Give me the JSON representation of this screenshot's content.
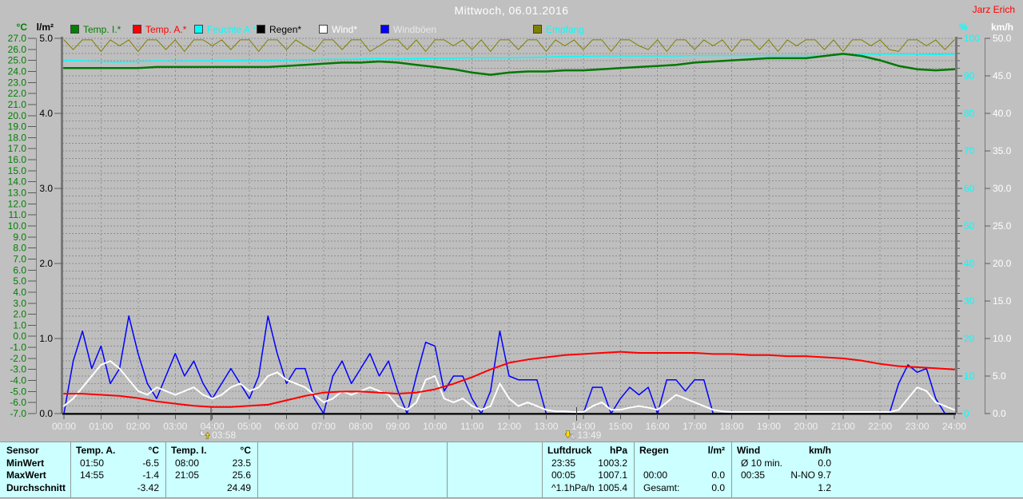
{
  "window": {
    "title": "Mittwoch, 06.01.2016",
    "watermark": "Jarz Erich"
  },
  "legend": {
    "items": [
      {
        "id": "temp-i",
        "label": "Temp. I.*",
        "swatch": "#008000",
        "text_color": "#008000"
      },
      {
        "id": "temp-a",
        "label": "Temp. A.*",
        "swatch": "#ff0000",
        "text_color": "#ff0000"
      },
      {
        "id": "feuchte-a",
        "label": "Feuchte A.*",
        "swatch": "#00ffff",
        "text_color": "#00ffff"
      },
      {
        "id": "regen",
        "label": "Regen*",
        "swatch": "#000000",
        "text_color": "#000000"
      },
      {
        "id": "wind",
        "label": "Wind*",
        "swatch": "#ffffff",
        "text_color": "#ffffff"
      },
      {
        "id": "windboeen",
        "label": "Windböen",
        "swatch": "#0000ff",
        "text_color": "#e8e8e8"
      },
      {
        "id": "empfang",
        "label": "Empfang",
        "swatch": "#808000",
        "text_color": "#00ffff"
      }
    ]
  },
  "colors": {
    "background": "#c0c0c0",
    "plot_bg": "#bebebe",
    "grid": "#8e8e8e",
    "axis_line": "#787878",
    "tick": "#5a5a5a",
    "x_label": "#f0f0f0",
    "baseline": "#000000",
    "table_bg": "#ccffff",
    "title": "#ffffff",
    "watermark": "#ff0000"
  },
  "chart_data": {
    "type": "line",
    "title": "Mittwoch, 06.01.2016",
    "x_axis": {
      "hours": 24,
      "labels": [
        "00:00",
        "01:00",
        "02:00",
        "03:00",
        "04:00",
        "05:00",
        "06:00",
        "07:00",
        "08:00",
        "09:00",
        "10:00",
        "11:00",
        "12:00",
        "13:00",
        "14:00",
        "15:00",
        "16:00",
        "17:00",
        "18:00",
        "19:00",
        "20:00",
        "21:00",
        "22:00",
        "23:00",
        "24:00"
      ]
    },
    "axes": {
      "temp_c": {
        "unit": "°C",
        "min": -7,
        "max": 27,
        "step": 1,
        "color": "#008000",
        "side": "left"
      },
      "rain_lm2": {
        "unit": "l/m²",
        "min": 0,
        "max": 5,
        "step": 1,
        "color": "#000000",
        "side": "left"
      },
      "humidity_pct": {
        "unit": "%",
        "min": 0,
        "max": 100,
        "step": 10,
        "minor_step": 2,
        "color": "#00ffff",
        "side": "right"
      },
      "wind_kmh": {
        "unit": "km/h",
        "min": 0,
        "max": 50,
        "step": 5,
        "color": "#ffffff",
        "side": "right"
      }
    },
    "markers": [
      {
        "time": "03:58",
        "hour": 3.967,
        "icon": "moonrise"
      },
      {
        "time": "13:49",
        "hour": 13.817,
        "icon": "moonset"
      }
    ],
    "series": [
      {
        "id": "empfang",
        "name": "Empfang",
        "axis": "humidity_pct",
        "color": "#808000",
        "width": 1,
        "interval_h": 0.25,
        "values": [
          99.6,
          97,
          99.6,
          99.6,
          96.5,
          99.6,
          98,
          99.6,
          96.5,
          99.6,
          99.6,
          97,
          99.6,
          96.5,
          99.6,
          99.6,
          98,
          99.6,
          97,
          99.6,
          99.6,
          96.5,
          99.6,
          99.6,
          97,
          99.6,
          98,
          96.5,
          99.6,
          99.6,
          97,
          99.6,
          99.6,
          96.5,
          98,
          99.6,
          99.6,
          97,
          99.6,
          96.5,
          99.6,
          99.6,
          98,
          99.6,
          97,
          99.6,
          96.5,
          99.6,
          99.6,
          97,
          99.6,
          99.6,
          96.5,
          99.6,
          98,
          99.6,
          97,
          99.6,
          99.6,
          96.5,
          99.6,
          99.6,
          98,
          97,
          99.6,
          96.5,
          99.6,
          99.6,
          97,
          99.6,
          98,
          99.6,
          96.5,
          99.6,
          99.6,
          97,
          99.6,
          96.5,
          99.6,
          98,
          99.6,
          99.6,
          97,
          99.6,
          96.5,
          99.6,
          99.6,
          98,
          99.6,
          97,
          96.5,
          99.6,
          99.6,
          98,
          99.6,
          97,
          99.6
        ]
      },
      {
        "id": "feuchte-a",
        "name": "Feuchte A.",
        "axis": "humidity_pct",
        "color": "#00ffff",
        "width": 1.5,
        "interval_h": 0.5,
        "values": [
          94.2,
          94.0,
          93.8,
          93.7,
          93.8,
          94.0,
          93.9,
          94.0,
          94.0,
          94.1,
          94.2,
          94.2,
          94.2,
          94.3,
          94.4,
          94.4,
          94.5,
          94.6,
          94.5,
          94.6,
          94.7,
          94.7,
          94.8,
          94.8,
          94.8,
          94.9,
          95.0,
          95.2,
          95.2,
          95.3,
          95.3,
          95.3,
          95.3,
          95.3,
          95.4,
          95.4,
          95.4,
          95.4,
          95.4,
          95.4,
          95.4,
          95.4,
          95.5,
          95.8,
          95.8,
          95.8,
          95.8,
          95.7,
          95.8
        ]
      },
      {
        "id": "temp-i",
        "name": "Temp. I.",
        "axis": "temp_c",
        "color": "#007800",
        "width": 2.5,
        "interval_h": 0.5,
        "values": [
          24.3,
          24.3,
          24.3,
          24.3,
          24.3,
          24.4,
          24.4,
          24.4,
          24.4,
          24.4,
          24.4,
          24.4,
          24.5,
          24.6,
          24.7,
          24.8,
          24.8,
          24.9,
          24.8,
          24.6,
          24.4,
          24.2,
          23.9,
          23.7,
          23.9,
          24.0,
          24.0,
          24.1,
          24.1,
          24.2,
          24.3,
          24.4,
          24.5,
          24.6,
          24.8,
          24.9,
          25.0,
          25.1,
          25.2,
          25.2,
          25.2,
          25.4,
          25.6,
          25.4,
          25.0,
          24.5,
          24.2,
          24.1,
          24.2
        ]
      },
      {
        "id": "windboeen",
        "name": "Windböen",
        "axis": "wind_kmh",
        "color": "#0000ff",
        "width": 1.5,
        "interval_h": 0.25,
        "values": [
          0,
          7,
          11,
          6,
          9,
          4,
          6,
          13,
          8,
          4,
          2,
          5,
          8,
          5,
          7,
          4,
          2,
          4,
          6,
          4,
          2,
          5,
          13,
          8,
          4,
          6,
          6,
          2,
          0,
          5,
          7,
          4,
          6,
          8,
          5,
          7,
          3,
          0,
          5,
          9.5,
          9,
          3,
          5,
          5,
          2,
          0,
          3,
          11,
          5,
          4.5,
          4.5,
          4.5,
          0,
          0,
          0,
          0,
          0,
          3.5,
          3.5,
          0,
          2,
          3.5,
          2.5,
          3.5,
          0,
          4.5,
          4.5,
          3,
          4.5,
          4.5,
          0,
          0,
          0,
          0,
          0,
          0,
          0,
          0,
          0,
          0,
          0,
          0,
          0,
          0,
          0,
          0,
          0,
          0,
          0,
          0,
          4,
          6.5,
          5.5,
          6,
          2,
          0,
          0
        ]
      },
      {
        "id": "wind",
        "name": "Wind",
        "axis": "wind_kmh",
        "color": "#ffffff",
        "width": 2,
        "interval_h": 0.25,
        "values": [
          1,
          2,
          3.5,
          5,
          6.5,
          7,
          6,
          4.5,
          3,
          2.5,
          3.5,
          3,
          2.5,
          3,
          3.5,
          2.5,
          2,
          2.5,
          3.5,
          4,
          3,
          3.5,
          5,
          5.5,
          4.5,
          4,
          3.5,
          2.5,
          1.5,
          2,
          3,
          2.5,
          3,
          3.5,
          3,
          2.5,
          1,
          0.5,
          1.5,
          4.5,
          5,
          2,
          1.5,
          2,
          1,
          0.5,
          1,
          4,
          2,
          1,
          1.5,
          1,
          0.5,
          0.3,
          0.3,
          0.2,
          0.2,
          1,
          1.5,
          0.5,
          0.5,
          0.8,
          1,
          0.8,
          0.5,
          1.5,
          2.5,
          2,
          1.5,
          1,
          0.5,
          0.3,
          0.2,
          0.2,
          0.2,
          0.2,
          0.2,
          0.2,
          0.2,
          0.2,
          0.2,
          0.2,
          0.2,
          0.2,
          0.2,
          0.2,
          0.2,
          0.2,
          0.2,
          0.2,
          0.5,
          2,
          3.5,
          3,
          1.5,
          1,
          0.5
        ]
      },
      {
        "id": "temp-a",
        "name": "Temp. A.",
        "axis": "temp_c",
        "color": "#ff0000",
        "width": 2,
        "interval_h": 0.5,
        "values": [
          -5.2,
          -5.2,
          -5.3,
          -5.4,
          -5.6,
          -5.9,
          -6.1,
          -6.3,
          -6.4,
          -6.4,
          -6.3,
          -6.2,
          -5.8,
          -5.4,
          -5.1,
          -5.0,
          -5.0,
          -5.1,
          -5.2,
          -5.1,
          -4.8,
          -4.3,
          -3.7,
          -3.0,
          -2.4,
          -2.1,
          -1.9,
          -1.7,
          -1.6,
          -1.5,
          -1.4,
          -1.5,
          -1.5,
          -1.5,
          -1.5,
          -1.6,
          -1.6,
          -1.7,
          -1.7,
          -1.8,
          -1.8,
          -1.9,
          -2.0,
          -2.2,
          -2.5,
          -2.7,
          -2.8,
          -2.9,
          -3.0
        ]
      },
      {
        "id": "regen",
        "name": "Regen",
        "axis": "rain_lm2",
        "color": "#000000",
        "width": 1.5,
        "interval_h": 24,
        "values": [
          0,
          0
        ]
      }
    ]
  },
  "stats_table": {
    "row_labels": [
      "Sensor",
      "MinWert",
      "MaxWert",
      "Durchschnitt"
    ],
    "columns": [
      {
        "name": "Temp. A.",
        "unit": "°C",
        "rows": [
          {
            "t": "01:50",
            "v": "-6.5"
          },
          {
            "t": "14:55",
            "v": "-1.4"
          },
          {
            "t": "",
            "v": "-3.42"
          }
        ]
      },
      {
        "name": "Temp. I.",
        "unit": "°C",
        "rows": [
          {
            "t": "08:00",
            "v": "23.5"
          },
          {
            "t": "21:05",
            "v": "25.6"
          },
          {
            "t": "",
            "v": "24.49"
          }
        ]
      },
      {
        "name": "",
        "unit": "",
        "rows": [
          {
            "t": "",
            "v": ""
          },
          {
            "t": "",
            "v": ""
          },
          {
            "t": "",
            "v": ""
          }
        ]
      },
      {
        "name": "",
        "unit": "",
        "rows": [
          {
            "t": "",
            "v": ""
          },
          {
            "t": "",
            "v": ""
          },
          {
            "t": "",
            "v": ""
          }
        ]
      },
      {
        "name": "",
        "unit": "",
        "rows": [
          {
            "t": "",
            "v": ""
          },
          {
            "t": "",
            "v": ""
          },
          {
            "t": "",
            "v": ""
          }
        ]
      },
      {
        "name": "Luftdruck",
        "unit": "hPa",
        "rows": [
          {
            "t": "23:35",
            "v": "1003.2"
          },
          {
            "t": "00:05",
            "v": "1007.1"
          },
          {
            "t": "^1.1hPa/h",
            "v": "1005.4"
          }
        ]
      },
      {
        "name": "Regen",
        "unit": "l/m²",
        "rows": [
          {
            "t": "",
            "v": ""
          },
          {
            "t": "00:00",
            "v": "0.0"
          },
          {
            "t": "Gesamt:",
            "v": "0.0"
          }
        ]
      },
      {
        "name": "Wind",
        "unit": "km/h",
        "rows": [
          {
            "t": "Ø 10 min.",
            "v": "0.0"
          },
          {
            "t": "00:35",
            "v": "N-NO 9.7"
          },
          {
            "t": "",
            "v": "1.2"
          }
        ]
      }
    ]
  }
}
